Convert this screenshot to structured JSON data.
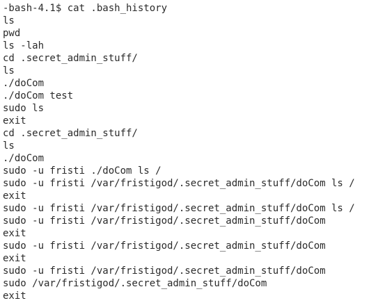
{
  "terminal": {
    "lines": [
      "-bash-4.1$ cat .bash_history",
      "ls",
      "pwd",
      "ls -lah",
      "cd .secret_admin_stuff/",
      "ls",
      "./doCom",
      "./doCom test",
      "sudo ls",
      "exit",
      "cd .secret_admin_stuff/",
      "ls",
      "./doCom",
      "sudo -u fristi ./doCom ls /",
      "sudo -u fristi /var/fristigod/.secret_admin_stuff/doCom ls /",
      "exit",
      "sudo -u fristi /var/fristigod/.secret_admin_stuff/doCom ls /",
      "sudo -u fristi /var/fristigod/.secret_admin_stuff/doCom",
      "exit",
      "sudo -u fristi /var/fristigod/.secret_admin_stuff/doCom",
      "exit",
      "sudo -u fristi /var/fristigod/.secret_admin_stuff/doCom",
      "sudo /var/fristigod/.secret_admin_stuff/doCom",
      "exit"
    ]
  },
  "colors": {
    "background": "#ffffff",
    "text": "#2b2b2b"
  }
}
